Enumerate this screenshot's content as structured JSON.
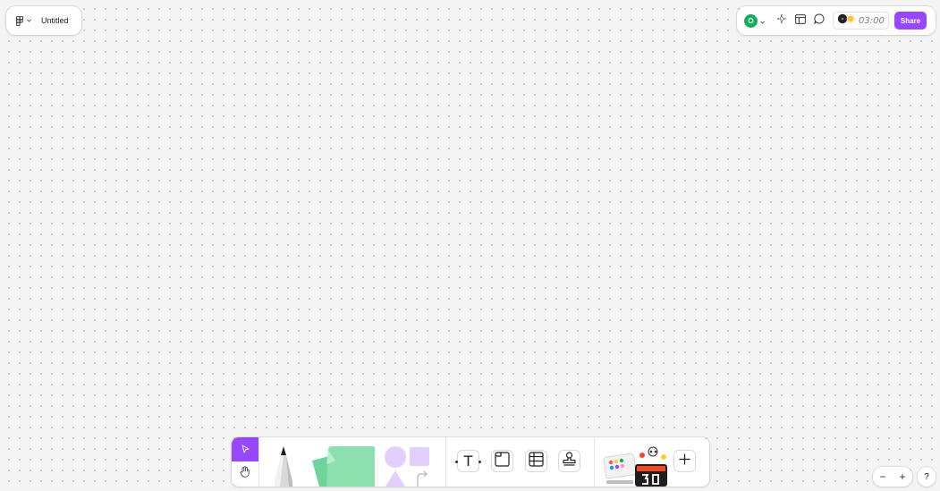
{
  "file": {
    "title": "Untitled",
    "menu_icon": "figjam-logo-icon",
    "menu_chevron_icon": "chevron-down-icon"
  },
  "top_right": {
    "avatar_initial": "O",
    "avatar_color": "#14ae5c",
    "timer_value": "03:00",
    "share_label": "Share",
    "share_color": "#9747ff",
    "icons": [
      "ai-sparkle-icon",
      "layout-icon",
      "comment-icon",
      "music-timer-icon"
    ]
  },
  "toolbar": {
    "active_tool": "move",
    "accent_color": "#9747ff",
    "tools": [
      "move-icon",
      "hand-icon",
      "marker-pen-icon",
      "sticky-note-icon",
      "shapes-icon",
      "text-icon",
      "section-icon",
      "table-icon",
      "stamp-icon",
      "stickers-icon",
      "plus-icon"
    ],
    "text_tool_glyph": "T"
  },
  "zoom": {
    "out_label": "−",
    "in_label": "+",
    "help_label": "?"
  }
}
